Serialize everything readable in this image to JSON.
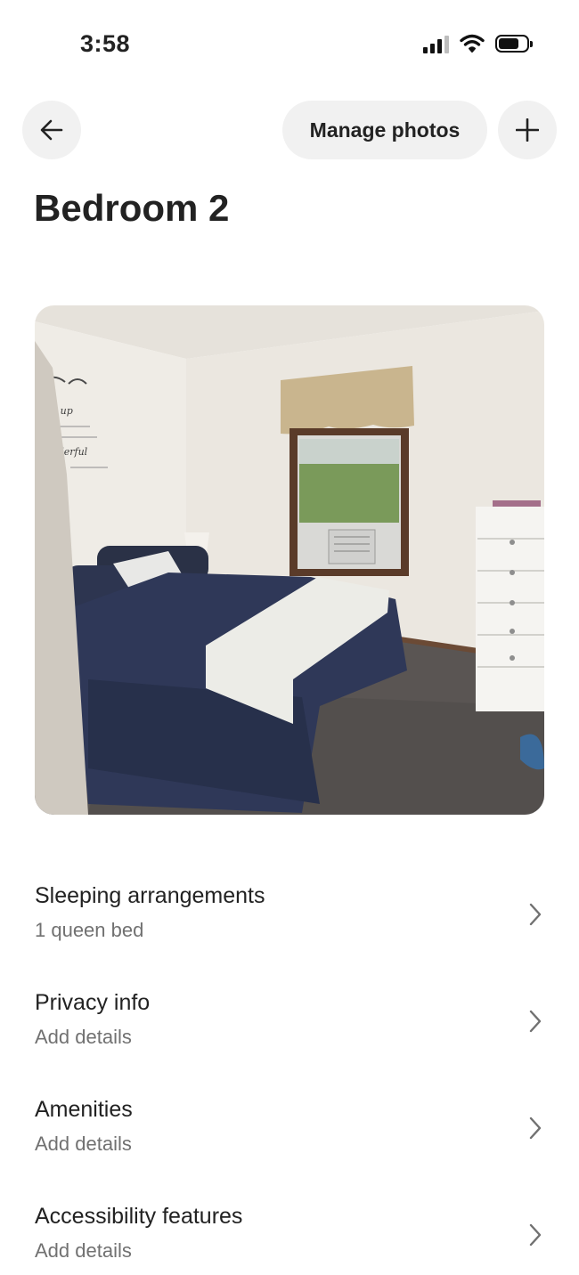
{
  "status_bar": {
    "time": "3:58"
  },
  "header": {
    "back_icon": "arrow-left-icon",
    "manage_photos_label": "Manage photos",
    "add_icon": "plus-icon"
  },
  "page": {
    "title": "Bedroom 2"
  },
  "photo": {
    "subject": "bedroom-photo"
  },
  "sections": [
    {
      "title": "Sleeping arrangements",
      "subtitle": "1 queen bed"
    },
    {
      "title": "Privacy info",
      "subtitle": "Add details"
    },
    {
      "title": "Amenities",
      "subtitle": "Add details"
    },
    {
      "title": "Accessibility features",
      "subtitle": "Add details"
    }
  ],
  "colors": {
    "text": "#222222",
    "secondary_text": "#717171",
    "button_bg": "#f1f1f1"
  }
}
